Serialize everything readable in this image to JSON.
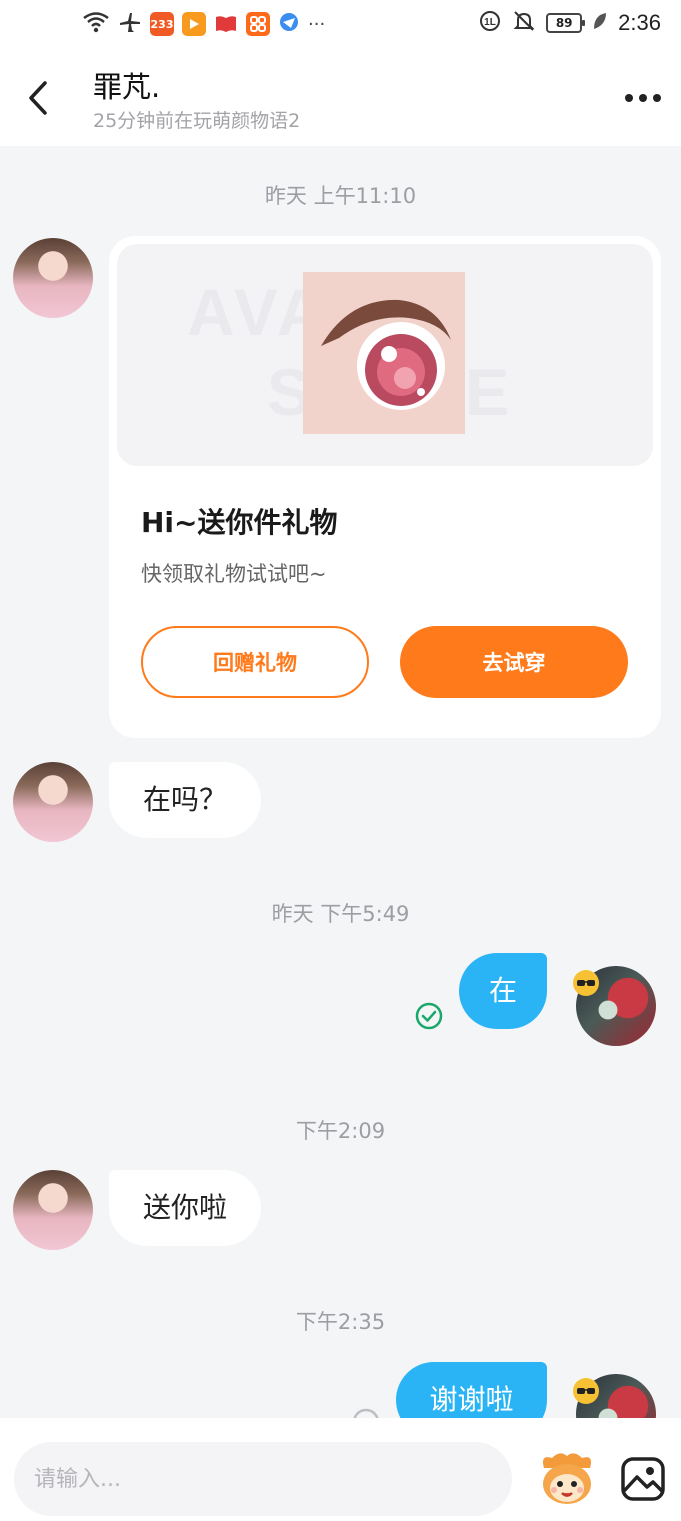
{
  "status_bar": {
    "time": "2:36",
    "battery": "89",
    "badge_233": "233",
    "more_dots": "···"
  },
  "header": {
    "title": "罪芃.",
    "subtitle": "25分钟前在玩萌颜物语2"
  },
  "messages": {
    "ts1": "昨天 上午11:10",
    "gift_card": {
      "title": "Hi~送你件礼物",
      "subtitle": "快领取礼物试试吧~",
      "button_return": "回赠礼物",
      "button_try": "去试穿",
      "banner_text_1": "AVATAR",
      "banner_text_2": "STORE"
    },
    "msg1": "在吗？",
    "ts2": "昨天 下午5:49",
    "msg2": "在",
    "ts3": "下午2:09",
    "msg3": "送你啦",
    "ts4": "下午2:35",
    "msg4": "谢谢啦"
  },
  "input": {
    "placeholder": "请输入..."
  },
  "colors": {
    "accent_orange": "#ff7a1a",
    "bubble_blue": "#2ab4f5",
    "read_green": "#1aa86a"
  },
  "icons": [
    "wifi-icon",
    "airplane-icon",
    "back-icon",
    "more-icon",
    "read-check-icon",
    "mascot-icon",
    "image-icon"
  ]
}
